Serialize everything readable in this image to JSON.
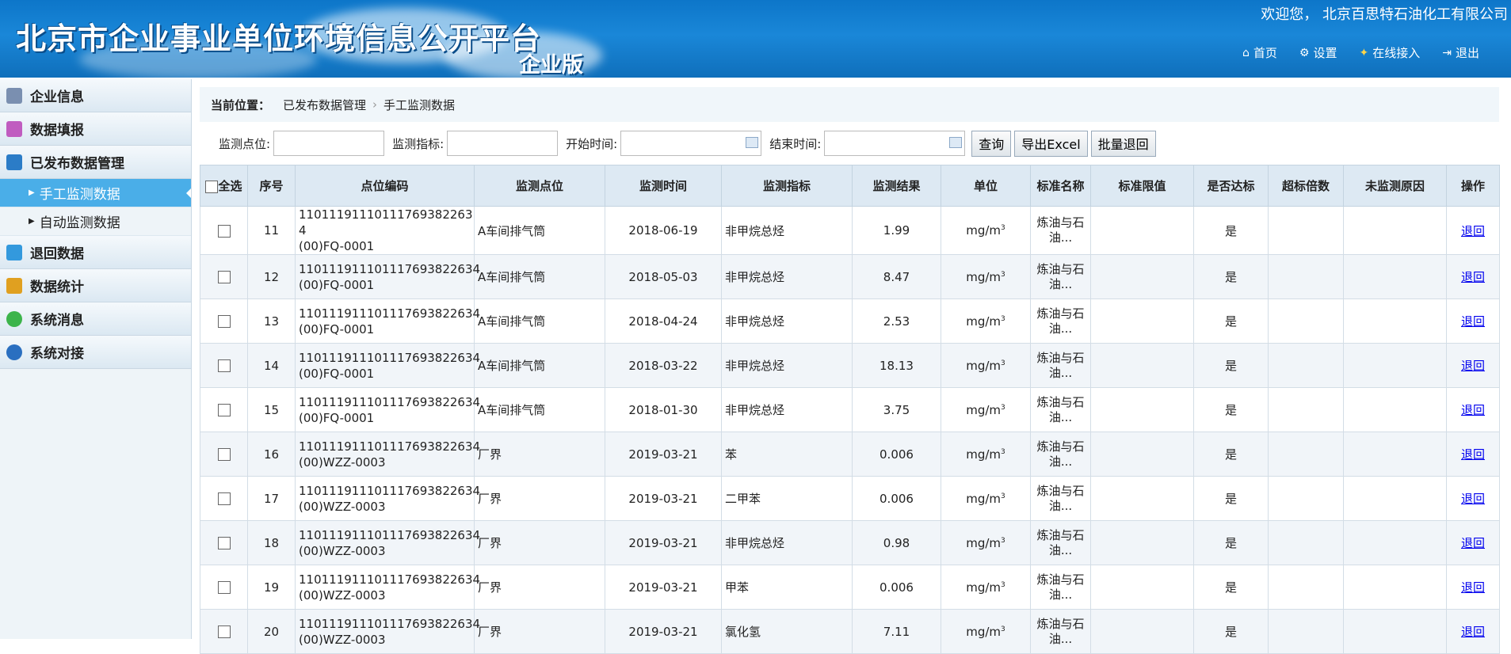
{
  "header": {
    "title": "北京市企业事业单位环境信息公开平台",
    "edition": "企业版",
    "welcome": "欢迎您， 北京百思特石油化工有限公司",
    "nav": [
      {
        "label": "首页",
        "icon": "home-icon"
      },
      {
        "label": "设置",
        "icon": "gear-icon"
      },
      {
        "label": "在线接入",
        "icon": "online-access-icon"
      },
      {
        "label": "退出",
        "icon": "logout-icon"
      }
    ]
  },
  "sidebar": {
    "items": [
      {
        "label": "企业信息",
        "icon": "company-info-icon",
        "color": "#7a8fb0"
      },
      {
        "label": "数据填报",
        "icon": "data-entry-icon",
        "color": "#c05cc0"
      },
      {
        "label": "已发布数据管理",
        "icon": "save-icon",
        "color": "#2b7cc7"
      },
      {
        "label": "退回数据",
        "icon": "return-icon",
        "color": "#3399dd"
      },
      {
        "label": "数据统计",
        "icon": "statistics-icon",
        "color": "#e0a020"
      },
      {
        "label": "系统消息",
        "icon": "message-icon",
        "color": "#3cb44b"
      },
      {
        "label": "系统对接",
        "icon": "system-link-icon",
        "color": "#2a6fc0"
      }
    ],
    "subitems": [
      {
        "label": "手工监测数据",
        "active": true
      },
      {
        "label": "自动监测数据",
        "active": false
      }
    ]
  },
  "breadcrumb": {
    "label": "当前位置：",
    "items": [
      "已发布数据管理",
      "手工监测数据"
    ]
  },
  "filters": {
    "point_label": "监测点位:",
    "indicator_label": "监测指标:",
    "start_label": "开始时间:",
    "end_label": "结束时间:",
    "query_button": "查询",
    "export_button": "导出Excel",
    "batch_return_button": "批量退回"
  },
  "table": {
    "select_all": "全选",
    "columns": [
      "序号",
      "点位编码",
      "监测点位",
      "监测时间",
      "监测指标",
      "监测结果",
      "单位",
      "标准名称",
      "标准限值",
      "是否达标",
      "超标倍数",
      "未监测原因",
      "操作"
    ],
    "rows": [
      {
        "no": "11",
        "code1": "11011191110111769382263 4",
        "code2": "(00)FQ-0001",
        "point": "A车间排气筒",
        "time": "2018-06-19",
        "indicator": "非甲烷总烃",
        "result": "1.99",
        "unit": "mg/m",
        "unit_sup": "3",
        "std1": "炼油与石",
        "std2": "油...",
        "limit": "",
        "ok": "是",
        "exceed": "",
        "reason": "",
        "action": "退回"
      },
      {
        "no": "12",
        "code1": "110111911101117693822634",
        "code2": "(00)FQ-0001",
        "point": "A车间排气筒",
        "time": "2018-05-03",
        "indicator": "非甲烷总烃",
        "result": "8.47",
        "unit": "mg/m",
        "unit_sup": "3",
        "std1": "炼油与石",
        "std2": "油...",
        "limit": "",
        "ok": "是",
        "exceed": "",
        "reason": "",
        "action": "退回"
      },
      {
        "no": "13",
        "code1": "110111911101117693822634",
        "code2": "(00)FQ-0001",
        "point": "A车间排气筒",
        "time": "2018-04-24",
        "indicator": "非甲烷总烃",
        "result": "2.53",
        "unit": "mg/m",
        "unit_sup": "3",
        "std1": "炼油与石",
        "std2": "油...",
        "limit": "",
        "ok": "是",
        "exceed": "",
        "reason": "",
        "action": "退回"
      },
      {
        "no": "14",
        "code1": "110111911101117693822634",
        "code2": "(00)FQ-0001",
        "point": "A车间排气筒",
        "time": "2018-03-22",
        "indicator": "非甲烷总烃",
        "result": "18.13",
        "unit": "mg/m",
        "unit_sup": "3",
        "std1": "炼油与石",
        "std2": "油...",
        "limit": "",
        "ok": "是",
        "exceed": "",
        "reason": "",
        "action": "退回"
      },
      {
        "no": "15",
        "code1": "110111911101117693822634",
        "code2": "(00)FQ-0001",
        "point": "A车间排气筒",
        "time": "2018-01-30",
        "indicator": "非甲烷总烃",
        "result": "3.75",
        "unit": "mg/m",
        "unit_sup": "3",
        "std1": "炼油与石",
        "std2": "油...",
        "limit": "",
        "ok": "是",
        "exceed": "",
        "reason": "",
        "action": "退回"
      },
      {
        "no": "16",
        "code1": "110111911101117693822634",
        "code2": "(00)WZZ-0003",
        "point": "厂界",
        "time": "2019-03-21",
        "indicator": "苯",
        "result": "0.006",
        "unit": "mg/m",
        "unit_sup": "3",
        "std1": "炼油与石",
        "std2": "油...",
        "limit": "",
        "ok": "是",
        "exceed": "",
        "reason": "",
        "action": "退回"
      },
      {
        "no": "17",
        "code1": "110111911101117693822634",
        "code2": "(00)WZZ-0003",
        "point": "厂界",
        "time": "2019-03-21",
        "indicator": "二甲苯",
        "result": "0.006",
        "unit": "mg/m",
        "unit_sup": "3",
        "std1": "炼油与石",
        "std2": "油...",
        "limit": "",
        "ok": "是",
        "exceed": "",
        "reason": "",
        "action": "退回"
      },
      {
        "no": "18",
        "code1": "110111911101117693822634",
        "code2": "(00)WZZ-0003",
        "point": "厂界",
        "time": "2019-03-21",
        "indicator": "非甲烷总烃",
        "result": "0.98",
        "unit": "mg/m",
        "unit_sup": "3",
        "std1": "炼油与石",
        "std2": "油...",
        "limit": "",
        "ok": "是",
        "exceed": "",
        "reason": "",
        "action": "退回"
      },
      {
        "no": "19",
        "code1": "110111911101117693822634",
        "code2": "(00)WZZ-0003",
        "point": "厂界",
        "time": "2019-03-21",
        "indicator": "甲苯",
        "result": "0.006",
        "unit": "mg/m",
        "unit_sup": "3",
        "std1": "炼油与石",
        "std2": "油...",
        "limit": "",
        "ok": "是",
        "exceed": "",
        "reason": "",
        "action": "退回"
      },
      {
        "no": "20",
        "code1": "110111911101117693822634",
        "code2": "(00)WZZ-0003",
        "point": "厂界",
        "time": "2019-03-21",
        "indicator": "氯化氢",
        "result": "7.11",
        "unit": "mg/m",
        "unit_sup": "3",
        "std1": "炼油与石",
        "std2": "油...",
        "limit": "",
        "ok": "是",
        "exceed": "",
        "reason": "",
        "action": "退回"
      }
    ]
  }
}
